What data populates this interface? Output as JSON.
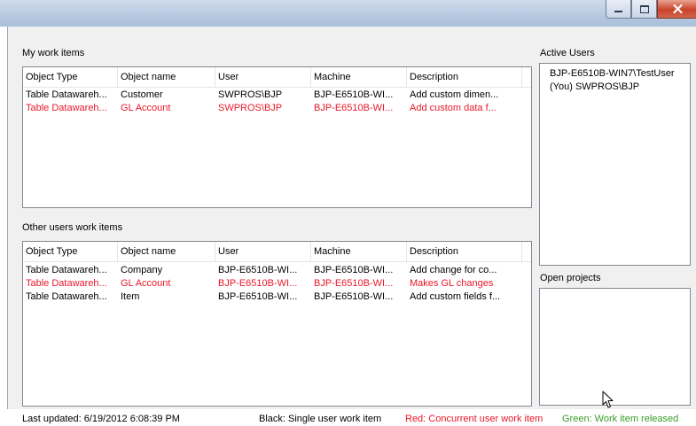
{
  "my_work": {
    "title": "My work items",
    "columns": [
      "Object Type",
      "Object name",
      "User",
      "Machine",
      "Description"
    ],
    "rows": [
      {
        "cells": [
          "Table Datawareh...",
          "Customer",
          "SWPROS\\BJP",
          "BJP-E6510B-WI...",
          "Add custom dimen..."
        ],
        "color": "#000000"
      },
      {
        "cells": [
          "Table Datawareh...",
          "GL Account",
          "SWPROS\\BJP",
          "BJP-E6510B-WI...",
          "Add custom data f..."
        ],
        "color": "#e8182a"
      }
    ]
  },
  "other_work": {
    "title": "Other users work items",
    "columns": [
      "Object Type",
      "Object name",
      "User",
      "Machine",
      "Description"
    ],
    "rows": [
      {
        "cells": [
          "Table Datawareh...",
          "Company",
          "BJP-E6510B-WI...",
          "BJP-E6510B-WI...",
          "Add change for co..."
        ],
        "color": "#000000"
      },
      {
        "cells": [
          "Table Datawareh...",
          "GL Account",
          "BJP-E6510B-WI...",
          "BJP-E6510B-WI...",
          "Makes GL changes"
        ],
        "color": "#e8182a"
      },
      {
        "cells": [
          "Table Datawareh...",
          "Item",
          "BJP-E6510B-WI...",
          "BJP-E6510B-WI...",
          "Add custom fields f..."
        ],
        "color": "#000000"
      }
    ]
  },
  "active_users": {
    "title": "Active Users",
    "items": [
      "BJP-E6510B-WIN7\\TestUser",
      "(You) SWPROS\\BJP"
    ]
  },
  "open_projects": {
    "title": "Open projects"
  },
  "status": {
    "last_updated": "Last updated: 6/19/2012 6:08:39 PM",
    "legend_black": "Black: Single user work item",
    "legend_red": "Red: Concurrent user work item",
    "legend_green": "Green: Work item released"
  },
  "colors": {
    "red": "#e8182a",
    "green": "#3a9d2a",
    "titlebar": "#bccde3",
    "close_button": "#c8432a"
  },
  "window_buttons": {
    "minimize": "minimize-icon",
    "maximize": "maximize-icon",
    "close": "close-icon"
  }
}
